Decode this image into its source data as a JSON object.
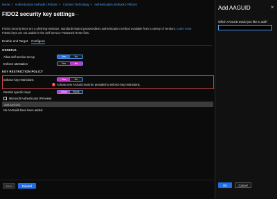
{
  "breadcrumb": [
    "Home",
    "Authentication methods | Policies",
    "Contoso Technology",
    "Authentication methods | Policies"
  ],
  "page": {
    "title": "FIDO2 security key settings",
    "description_line1": "FIDO2 security keys are a phishing-resistant, standards-based passwordless authentication method available from a variety of vendors.",
    "learn_more": "Learn more.",
    "description_line2": "FIDO2 keys are not usable in the Self Service Password Reset flow."
  },
  "tabs": [
    {
      "label": "Enable and Target",
      "active": false
    },
    {
      "label": "Configure",
      "active": true
    }
  ],
  "general": {
    "section": "GENERAL",
    "self_service": {
      "label": "Allow self-service set up",
      "on": "Yes",
      "off": "No",
      "selected": "Yes"
    },
    "attestation": {
      "label": "Enforce attestation",
      "on": "Yes",
      "off": "No",
      "selected": "No"
    }
  },
  "key_restriction": {
    "section": "KEY RESTRICTION POLICY",
    "enforce": {
      "label": "Enforce key restrictions",
      "on": "Yes",
      "off": "No",
      "selected": "Yes"
    },
    "error_text": "At least one AAGuid must be provided to enforce key restrictions.",
    "restrict": {
      "label": "Restrict specific keys",
      "allow": "Allow",
      "block": "Block",
      "selected": "Allow"
    },
    "authenticator_label": "Microsoft Authenticator (Preview)",
    "table_header": "Add AAGUID",
    "table_empty": "No AAGuids have been added."
  },
  "footer": {
    "save": "Save",
    "discard": "Discard"
  },
  "panel": {
    "title": "Add AAGUID",
    "field_label": "Which AAGUID would you like to add?",
    "field_value": "",
    "ok": "OK",
    "cancel": "Cancel"
  },
  "colors": {
    "accent": "#1f6feb",
    "magenta": "#c339c9",
    "error": "#c74447"
  },
  "icons": [
    "close-icon",
    "error-icon",
    "checkbox-icon",
    "more-icon"
  ]
}
